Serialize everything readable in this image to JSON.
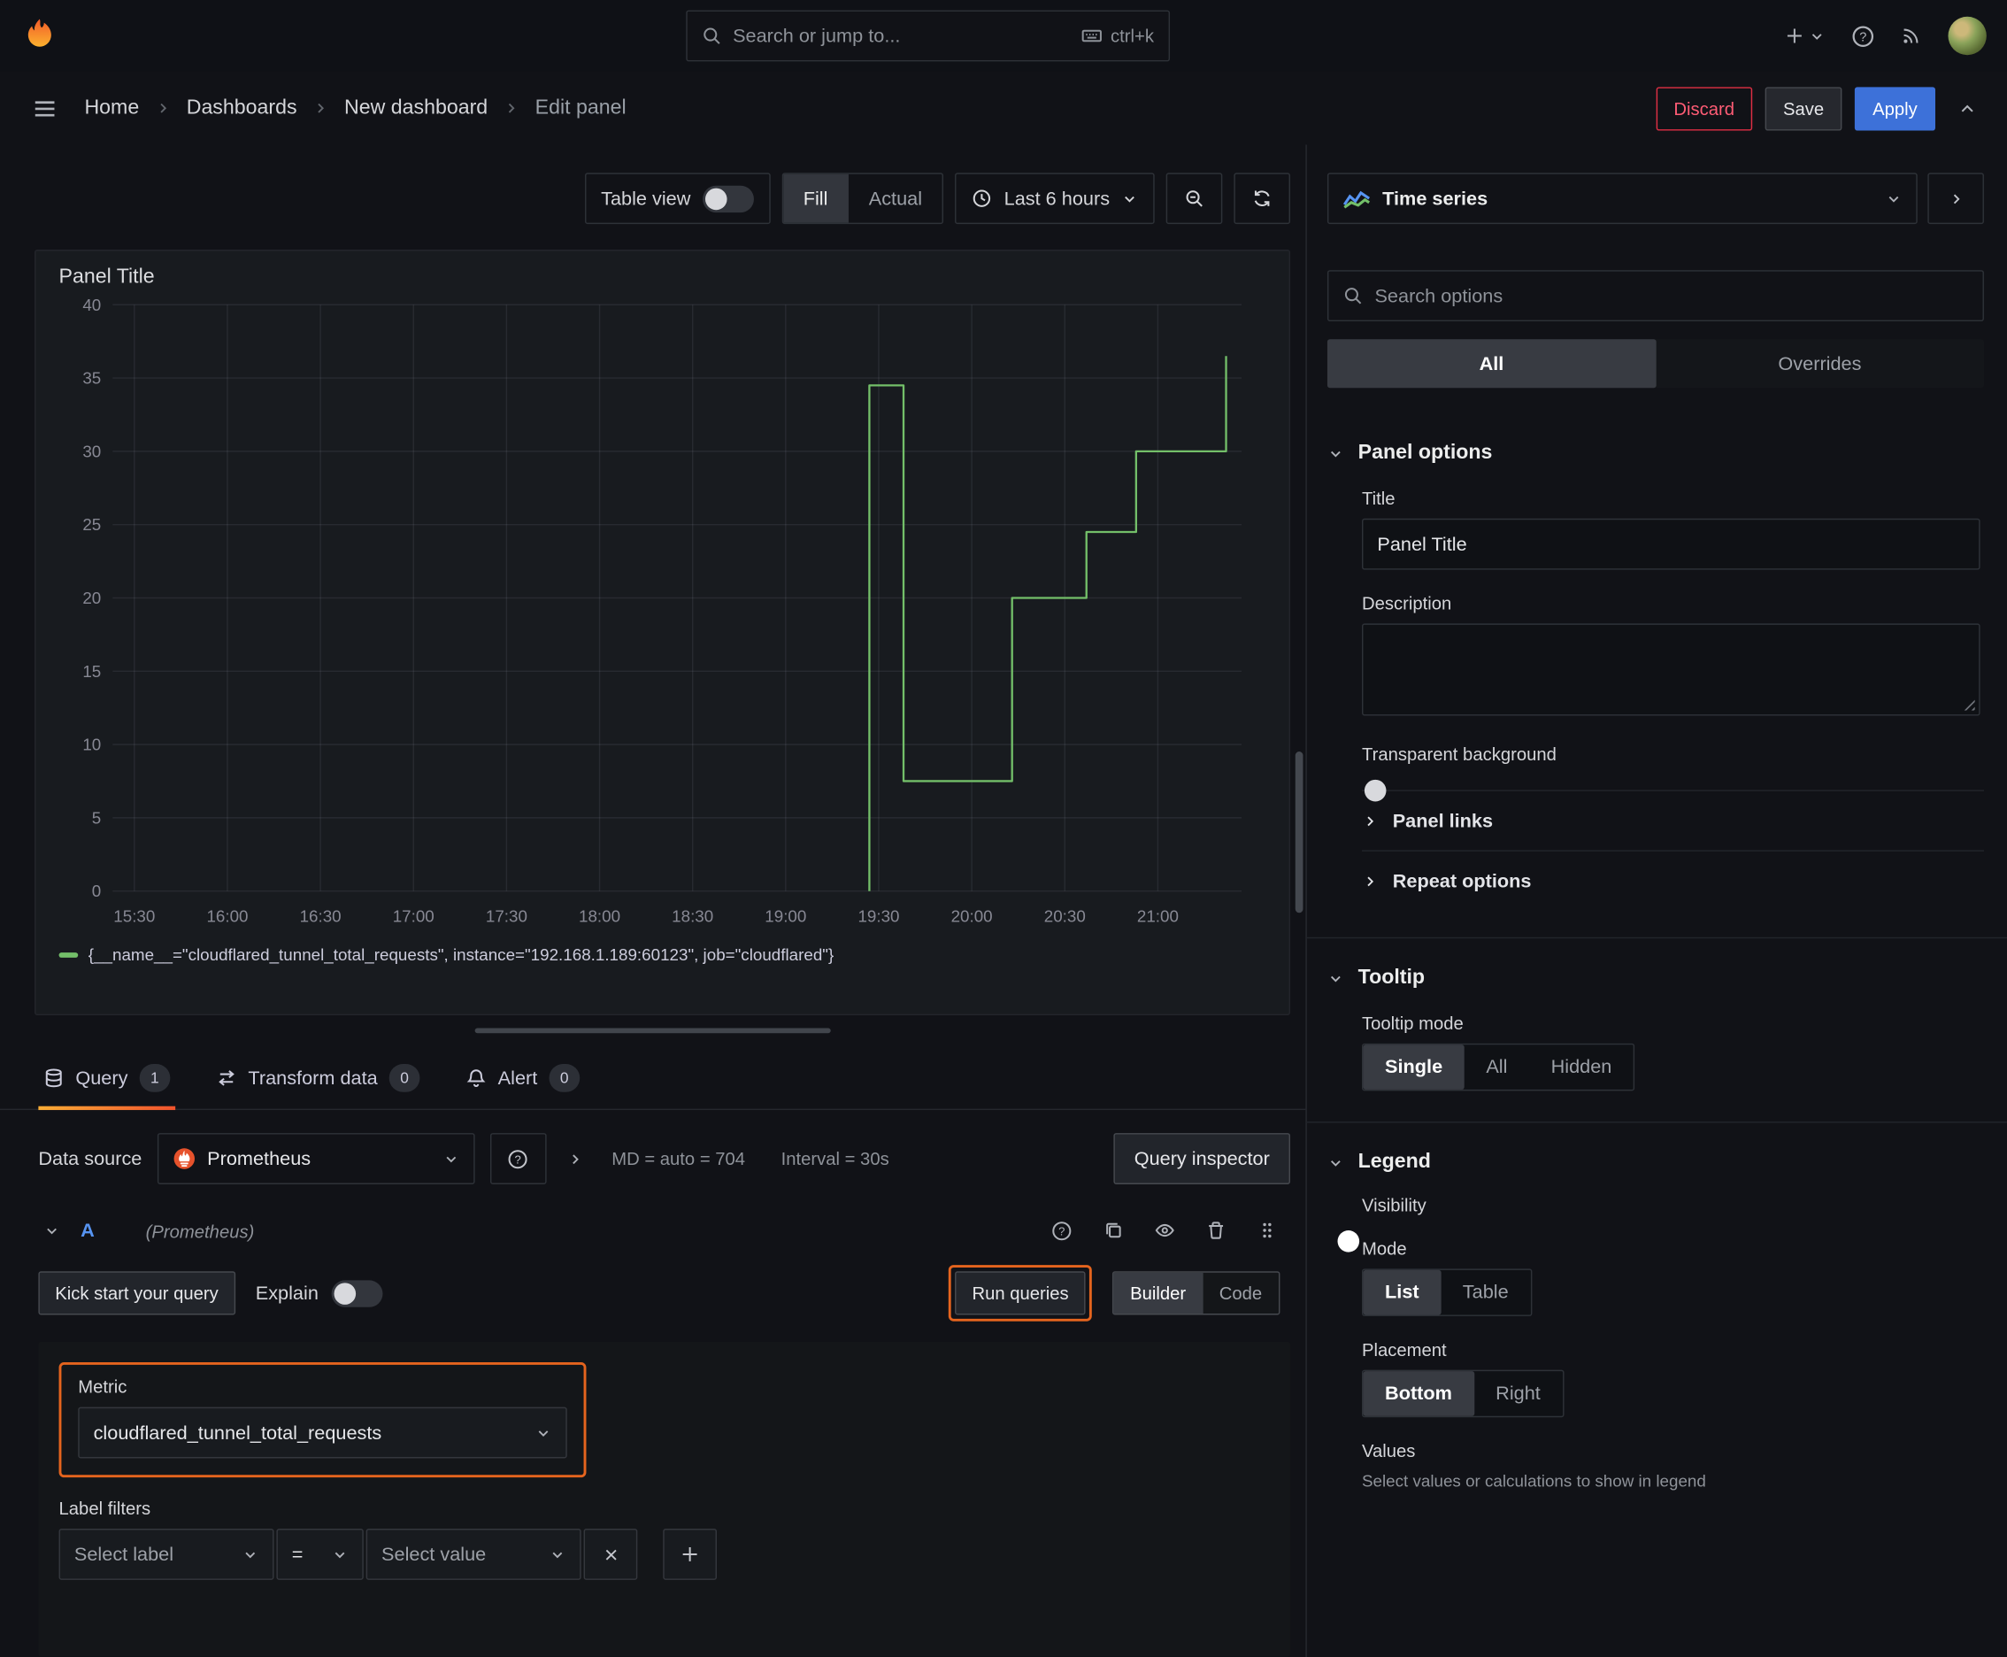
{
  "colors": {
    "accent_blue": "#3d71d9",
    "highlight_orange": "#e5641e",
    "series_green": "#73bf69",
    "danger_red": "#e02f44"
  },
  "topbar": {
    "search_placeholder": "Search or jump to...",
    "search_shortcut": "ctrl+k"
  },
  "breadcrumb": {
    "items": [
      "Home",
      "Dashboards",
      "New dashboard",
      "Edit panel"
    ]
  },
  "actions": {
    "discard": "Discard",
    "save": "Save",
    "apply": "Apply"
  },
  "toolbar": {
    "table_view": "Table view",
    "fill": "Fill",
    "actual": "Actual",
    "time_range": "Last 6 hours"
  },
  "panel": {
    "title": "Panel Title"
  },
  "chart_data": {
    "type": "line",
    "title": "Panel Title",
    "x_ticks": [
      "15:30",
      "16:00",
      "16:30",
      "17:00",
      "17:30",
      "18:00",
      "18:30",
      "19:00",
      "19:30",
      "20:00",
      "20:30",
      "21:00"
    ],
    "x_tick_interval_minutes": 30,
    "x_unit": "minutes_after_15:30",
    "x_range_minutes": [
      -7,
      357
    ],
    "y_ticks": [
      0,
      5,
      10,
      15,
      20,
      25,
      30,
      35,
      40
    ],
    "ylim": [
      0,
      40
    ],
    "grid": true,
    "legend_position": "bottom",
    "series": [
      {
        "name": "{__name__=\"cloudflared_tunnel_total_requests\", instance=\"192.168.1.189:60123\", job=\"cloudflared\"}",
        "color": "#73bf69",
        "points": [
          [
            237,
            0
          ],
          [
            237,
            34.5
          ],
          [
            248,
            34.5
          ],
          [
            248,
            7.5
          ],
          [
            283,
            7.5
          ],
          [
            283,
            20
          ],
          [
            307,
            20
          ],
          [
            307,
            24.5
          ],
          [
            323,
            24.5
          ],
          [
            323,
            30
          ],
          [
            352,
            30
          ],
          [
            352,
            36.5
          ]
        ]
      }
    ]
  },
  "tabs": {
    "query": "Query",
    "query_count": "1",
    "transform": "Transform data",
    "transform_count": "0",
    "alert": "Alert",
    "alert_count": "0"
  },
  "query": {
    "datasource_label": "Data source",
    "datasource_value": "Prometheus",
    "md_stat": "MD = auto = 704",
    "interval_stat": "Interval = 30s",
    "inspector": "Query inspector",
    "ref_id": "A",
    "ref_type": "(Prometheus)",
    "kick_start": "Kick start your query",
    "explain": "Explain",
    "run_queries": "Run queries",
    "builder": "Builder",
    "code": "Code",
    "metric_label": "Metric",
    "metric_value": "cloudflared_tunnel_total_requests",
    "label_filters": "Label filters",
    "select_label": "Select label",
    "operator": "=",
    "select_value": "Select value"
  },
  "options": {
    "viz_type": "Time series",
    "search_placeholder": "Search options",
    "tab_all": "All",
    "tab_overrides": "Overrides",
    "panel_options": "Panel options",
    "title_label": "Title",
    "title_value": "Panel Title",
    "description_label": "Description",
    "transparent_bg": "Transparent background",
    "panel_links": "Panel links",
    "repeat_options": "Repeat options",
    "tooltip": "Tooltip",
    "tooltip_mode": "Tooltip mode",
    "tooltip_single": "Single",
    "tooltip_all": "All",
    "tooltip_hidden": "Hidden",
    "legend": "Legend",
    "visibility": "Visibility",
    "mode": "Mode",
    "mode_list": "List",
    "mode_table": "Table",
    "placement": "Placement",
    "placement_bottom": "Bottom",
    "placement_right": "Right",
    "values": "Values",
    "values_help": "Select values or calculations to show in legend"
  }
}
